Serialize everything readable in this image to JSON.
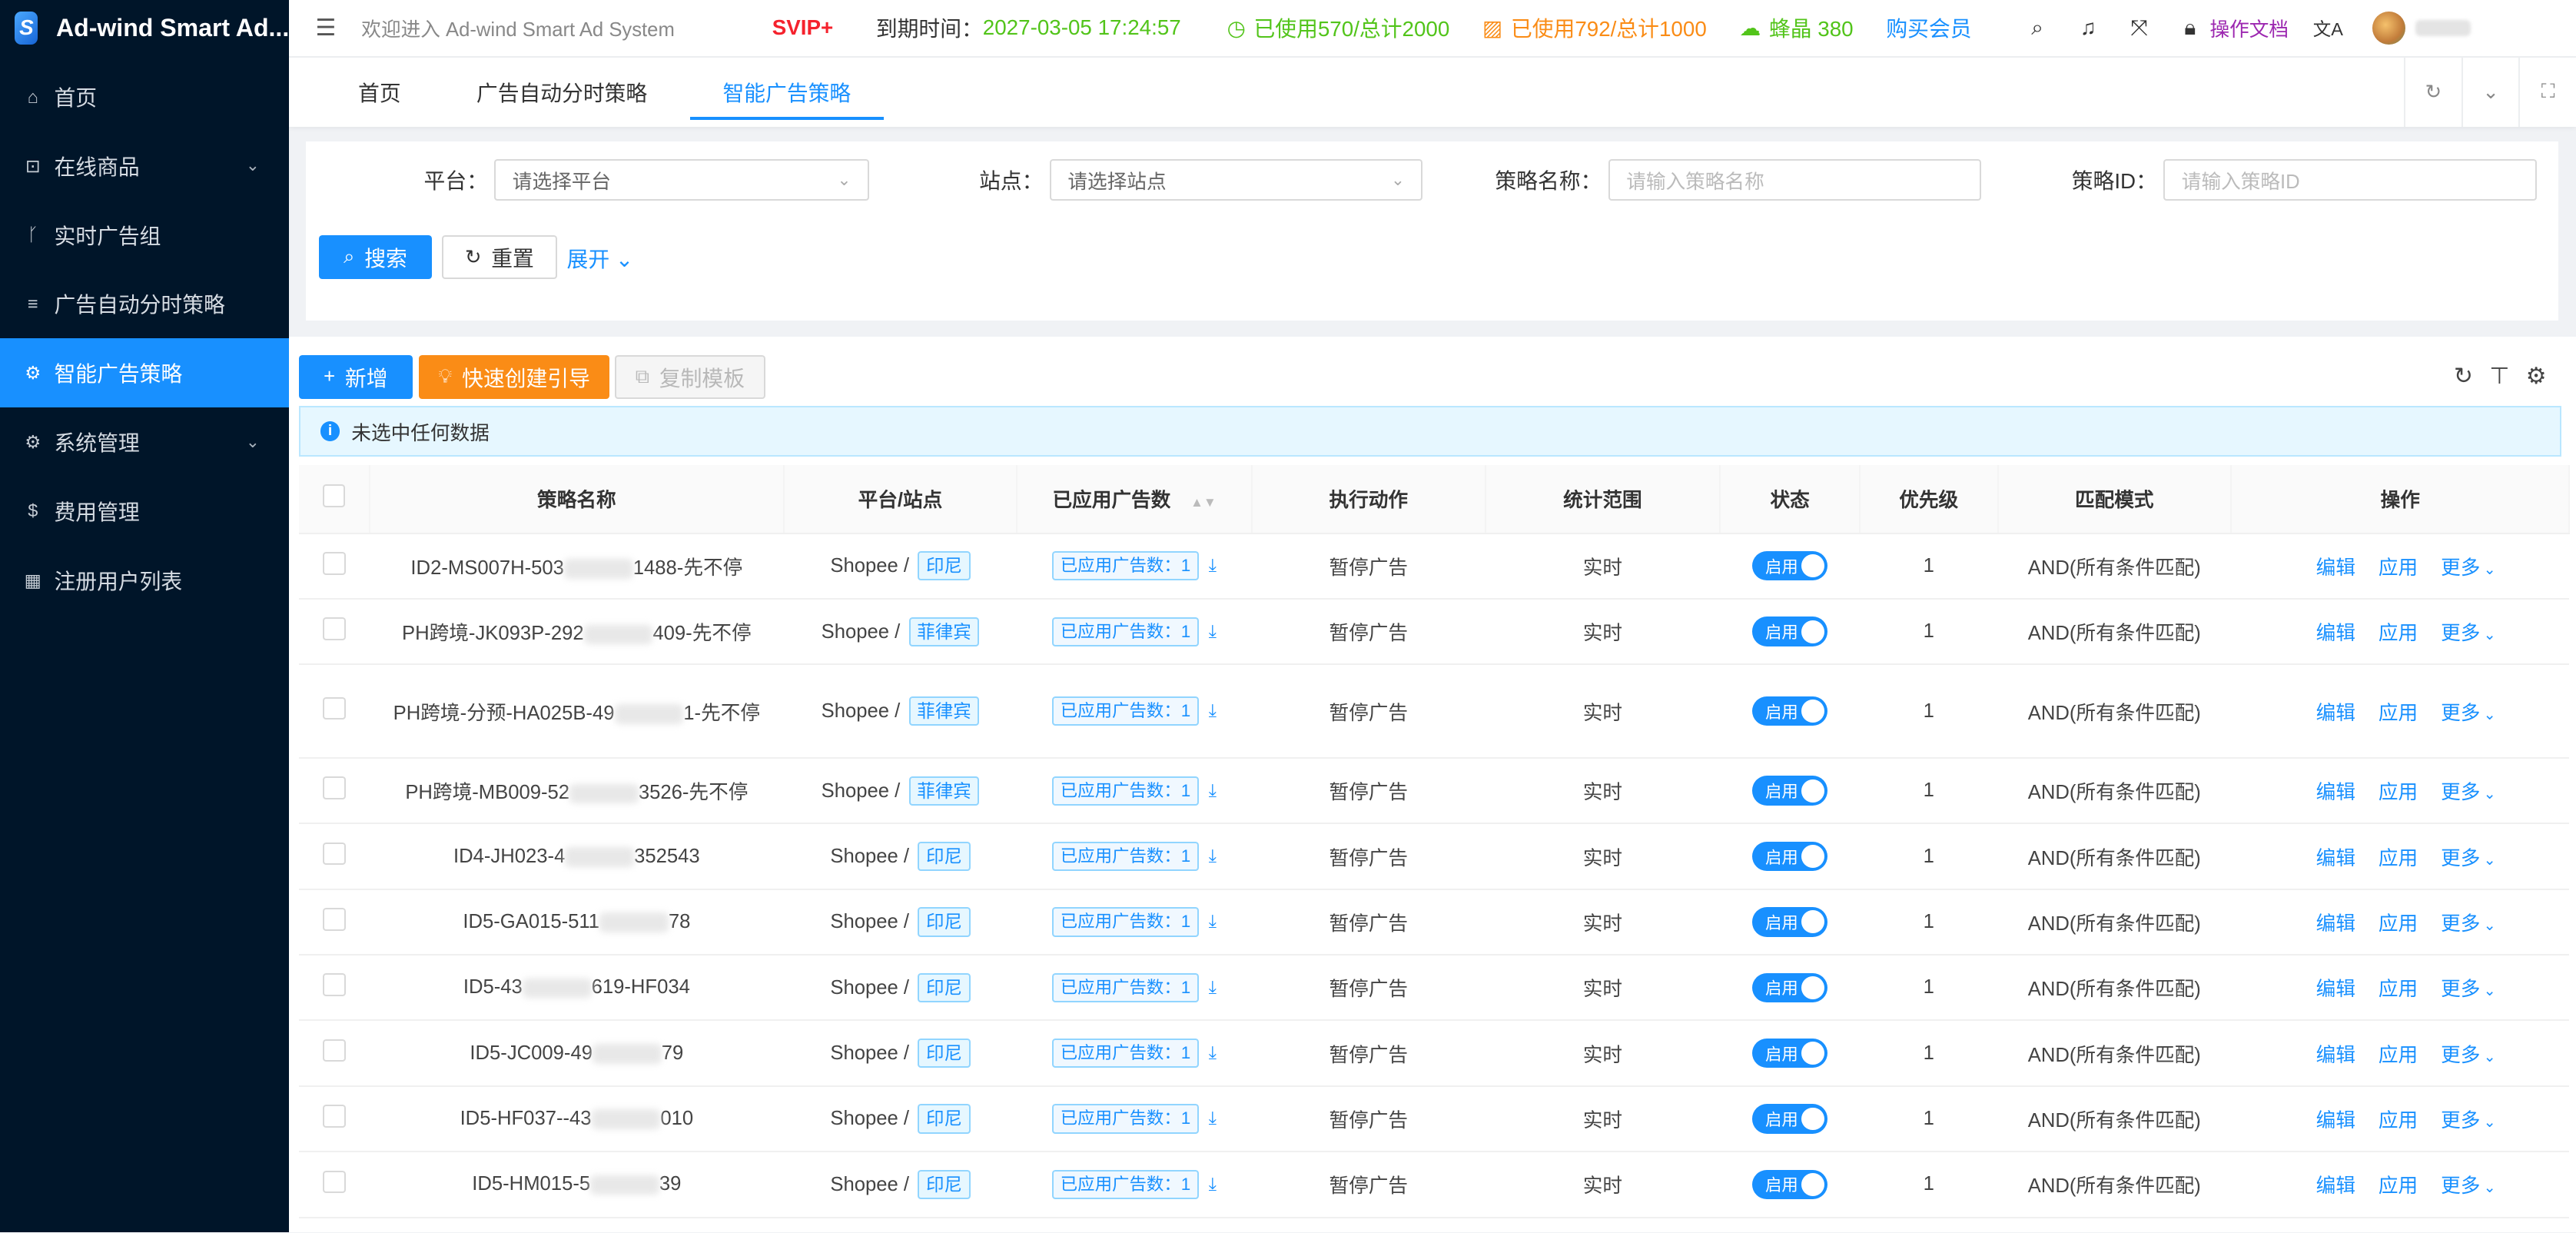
{
  "app": {
    "title": "Ad-wind Smart Ad..."
  },
  "sidebar": {
    "items": [
      {
        "label": "首页",
        "icon": "bank-icon",
        "glyph": "⌂",
        "hasArrow": false,
        "active": false
      },
      {
        "label": "在线商品",
        "icon": "shopping-bag-icon",
        "glyph": "⊡",
        "hasArrow": true,
        "active": false
      },
      {
        "label": "实时广告组",
        "icon": "branch-icon",
        "glyph": "ᚴ",
        "hasArrow": false,
        "active": false
      },
      {
        "label": "广告自动分时策略",
        "icon": "list-icon",
        "glyph": "≡",
        "hasArrow": false,
        "active": false
      },
      {
        "label": "智能广告策略",
        "icon": "gear-icon",
        "glyph": "⚙",
        "hasArrow": false,
        "active": true
      },
      {
        "label": "系统管理",
        "icon": "gear-icon",
        "glyph": "⚙",
        "hasArrow": true,
        "active": false
      },
      {
        "label": "费用管理",
        "icon": "dollar-icon",
        "glyph": "$",
        "hasArrow": false,
        "active": false
      },
      {
        "label": "注册用户列表",
        "icon": "grid-icon",
        "glyph": "▦",
        "hasArrow": false,
        "active": false
      }
    ]
  },
  "topbar": {
    "welcome": "欢迎进入 Ad-wind Smart Ad System",
    "svip": "SVIP+",
    "expire_label": "到期时间：",
    "expire_time": "2027-03-05 17:24:57",
    "quota1": "已使用570/总计2000",
    "quota2": "已使用792/总计1000",
    "crystal": "蜂晶 380",
    "buy": "购买会员",
    "docs": "操作文档",
    "lang": "文A"
  },
  "tabs": [
    {
      "label": "首页",
      "active": false
    },
    {
      "label": "广告自动分时策略",
      "active": false
    },
    {
      "label": "智能广告策略",
      "active": true
    }
  ],
  "search": {
    "platform_label": "平台：",
    "platform_placeholder": "请选择平台",
    "site_label": "站点：",
    "site_placeholder": "请选择站点",
    "name_label": "策略名称：",
    "name_placeholder": "请输入策略名称",
    "id_label": "策略ID：",
    "id_placeholder": "请输入策略ID",
    "search_btn": "搜索",
    "reset_btn": "重置",
    "expand": "展开"
  },
  "toolbar": {
    "add": "新增",
    "quick": "快速创建引导",
    "copy": "复制模板"
  },
  "alert": "未选中任何数据",
  "table": {
    "headers": [
      "策略名称",
      "平台/站点",
      "已应用广告数",
      "执行动作",
      "统计范围",
      "状态",
      "优先级",
      "匹配模式",
      "操作"
    ],
    "rows": [
      {
        "pre": "ID2-MS007H-503",
        "post": "1488-先不停",
        "platform": "Shopee /",
        "site": "印尼",
        "ads": "已应用广告数：1",
        "action": "暂停广告",
        "scope": "实时",
        "status": "启用",
        "priority": "1",
        "match": "AND(所有条件匹配)",
        "tall": false
      },
      {
        "pre": "PH跨境-JK093P-292",
        "post": "409-先不停",
        "platform": "Shopee /",
        "site": "菲律宾",
        "ads": "已应用广告数：1",
        "action": "暂停广告",
        "scope": "实时",
        "status": "启用",
        "priority": "1",
        "match": "AND(所有条件匹配)",
        "tall": false
      },
      {
        "pre": "PH跨境-分预-HA025B-49",
        "post": "1-先不停",
        "platform": "Shopee /",
        "site": "菲律宾",
        "ads": "已应用广告数：1",
        "action": "暂停广告",
        "scope": "实时",
        "status": "启用",
        "priority": "1",
        "match": "AND(所有条件匹配)",
        "tall": true
      },
      {
        "pre": "PH跨境-MB009-52",
        "post": "3526-先不停",
        "platform": "Shopee /",
        "site": "菲律宾",
        "ads": "已应用广告数：1",
        "action": "暂停广告",
        "scope": "实时",
        "status": "启用",
        "priority": "1",
        "match": "AND(所有条件匹配)",
        "tall": false
      },
      {
        "pre": "ID4-JH023-4",
        "post": "352543",
        "platform": "Shopee /",
        "site": "印尼",
        "ads": "已应用广告数：1",
        "action": "暂停广告",
        "scope": "实时",
        "status": "启用",
        "priority": "1",
        "match": "AND(所有条件匹配)",
        "tall": false
      },
      {
        "pre": "ID5-GA015-511",
        "post": "78",
        "platform": "Shopee /",
        "site": "印尼",
        "ads": "已应用广告数：1",
        "action": "暂停广告",
        "scope": "实时",
        "status": "启用",
        "priority": "1",
        "match": "AND(所有条件匹配)",
        "tall": false
      },
      {
        "pre": "ID5-43",
        "post": "619-HF034",
        "platform": "Shopee /",
        "site": "印尼",
        "ads": "已应用广告数：1",
        "action": "暂停广告",
        "scope": "实时",
        "status": "启用",
        "priority": "1",
        "match": "AND(所有条件匹配)",
        "tall": false
      },
      {
        "pre": "ID5-JC009-49",
        "post": "79",
        "platform": "Shopee /",
        "site": "印尼",
        "ads": "已应用广告数：1",
        "action": "暂停广告",
        "scope": "实时",
        "status": "启用",
        "priority": "1",
        "match": "AND(所有条件匹配)",
        "tall": false
      },
      {
        "pre": "ID5-HF037--43",
        "post": "010",
        "platform": "Shopee /",
        "site": "印尼",
        "ads": "已应用广告数：1",
        "action": "暂停广告",
        "scope": "实时",
        "status": "启用",
        "priority": "1",
        "match": "AND(所有条件匹配)",
        "tall": false
      },
      {
        "pre": "ID5-HM015-5",
        "post": "39",
        "platform": "Shopee /",
        "site": "印尼",
        "ads": "已应用广告数：1",
        "action": "暂停广告",
        "scope": "实时",
        "status": "启用",
        "priority": "1",
        "match": "AND(所有条件匹配)",
        "tall": false
      }
    ],
    "actions": {
      "edit": "编辑",
      "apply": "应用",
      "more": "更多"
    }
  },
  "colors": {
    "primary": "#1890ff",
    "sidebar": "#001529",
    "orange": "#fa8c16",
    "green": "#52c41a",
    "red": "#f5222d",
    "purple": "#9c27b0"
  }
}
